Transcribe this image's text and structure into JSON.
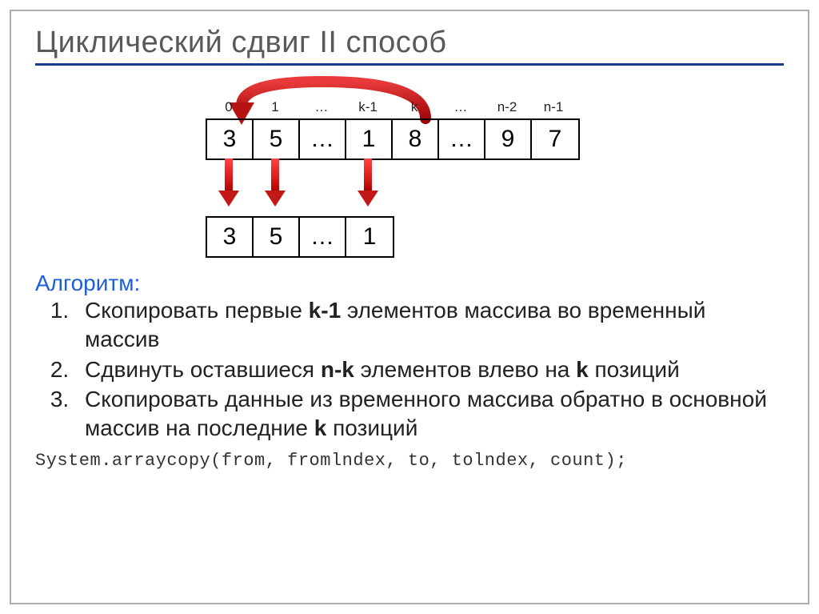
{
  "title": "Циклический сдвиг II способ",
  "indices": [
    "0",
    "1",
    "…",
    "k-1",
    "k",
    "…",
    "n-2",
    "n-1"
  ],
  "array_top": [
    "3",
    "5",
    "…",
    "1",
    "8",
    "…",
    "9",
    "7"
  ],
  "array_bottom": [
    "3",
    "5",
    "…",
    "1"
  ],
  "algo_label": "Алгоритм:",
  "steps": {
    "s1a": "Скопировать первые ",
    "s1b": "k-1",
    "s1c": " элементов массива во временный массив",
    "s2a": "Сдвинуть оставшиеся ",
    "s2b": "n-k",
    "s2c": " элементов влево на ",
    "s2d": "k",
    "s2e": " позиций",
    "s3a": "Скопировать данные из временного массива обратно в основной массив на последние ",
    "s3b": "k",
    "s3c": " позиций"
  },
  "code": "System.arraycopy(from, fromlndex, to, tolndex, count);",
  "chart_data": {
    "type": "diagram",
    "description": "Cyclic shift of an array, method II",
    "source_array_indices": [
      "0",
      "1",
      "…",
      "k-1",
      "k",
      "…",
      "n-2",
      "n-1"
    ],
    "source_array_values": [
      "3",
      "5",
      "…",
      "1",
      "8",
      "…",
      "9",
      "7"
    ],
    "temp_array_values": [
      "3",
      "5",
      "…",
      "1"
    ],
    "copy_down_arrows_from_columns": [
      0,
      1,
      3
    ],
    "wrap_arrow": {
      "from_index": "k",
      "to": "start"
    }
  }
}
